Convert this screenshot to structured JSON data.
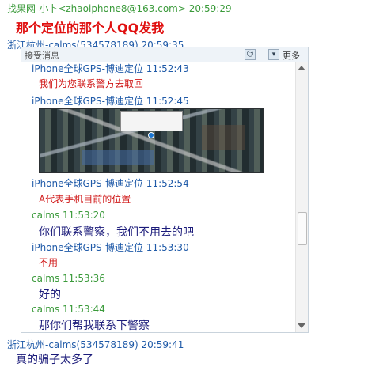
{
  "outer": {
    "header1": "找果网-小卜<zhaoiphone8@163.com> 20:59:29",
    "message1": "那个定位的那个人QQ发我",
    "header2": "浙江杭州-calms(534578189) 20:59:35",
    "header3": "浙江杭州-calms(534578189) 20:59:41",
    "message3": "真的骗子太多了"
  },
  "embedded": {
    "toolbar_label": "接受消息",
    "more_label": "更多",
    "messages": [
      {
        "sender": "iPhone全球GPS-博迪定位 11:52:43",
        "content": "我们为您联系警方去取回"
      },
      {
        "sender": "iPhone全球GPS-博迪定位 11:52:45",
        "content": ""
      },
      {
        "sender": "iPhone全球GPS-博迪定位 11:52:54",
        "content": "A代表手机目前的位置"
      },
      {
        "sender": "calms 11:53:20",
        "content": "你们联系警察，我们不用去的吧"
      },
      {
        "sender": "iPhone全球GPS-博迪定位 11:53:30",
        "content": "不用"
      },
      {
        "sender": "calms 11:53:36",
        "content": "好的"
      },
      {
        "sender": "calms 11:53:44",
        "content": "那你们帮我联系下警察"
      }
    ]
  },
  "colors": {
    "sender_company": "#1f5aa8",
    "sender_user": "#3a9a3a",
    "company_text": "#d01818",
    "user_text": "#1b1b7a"
  },
  "icons": {
    "map_marker": "location-pin-icon",
    "scroll_up": "scroll-up-icon",
    "scroll_down": "scroll-down-icon"
  }
}
